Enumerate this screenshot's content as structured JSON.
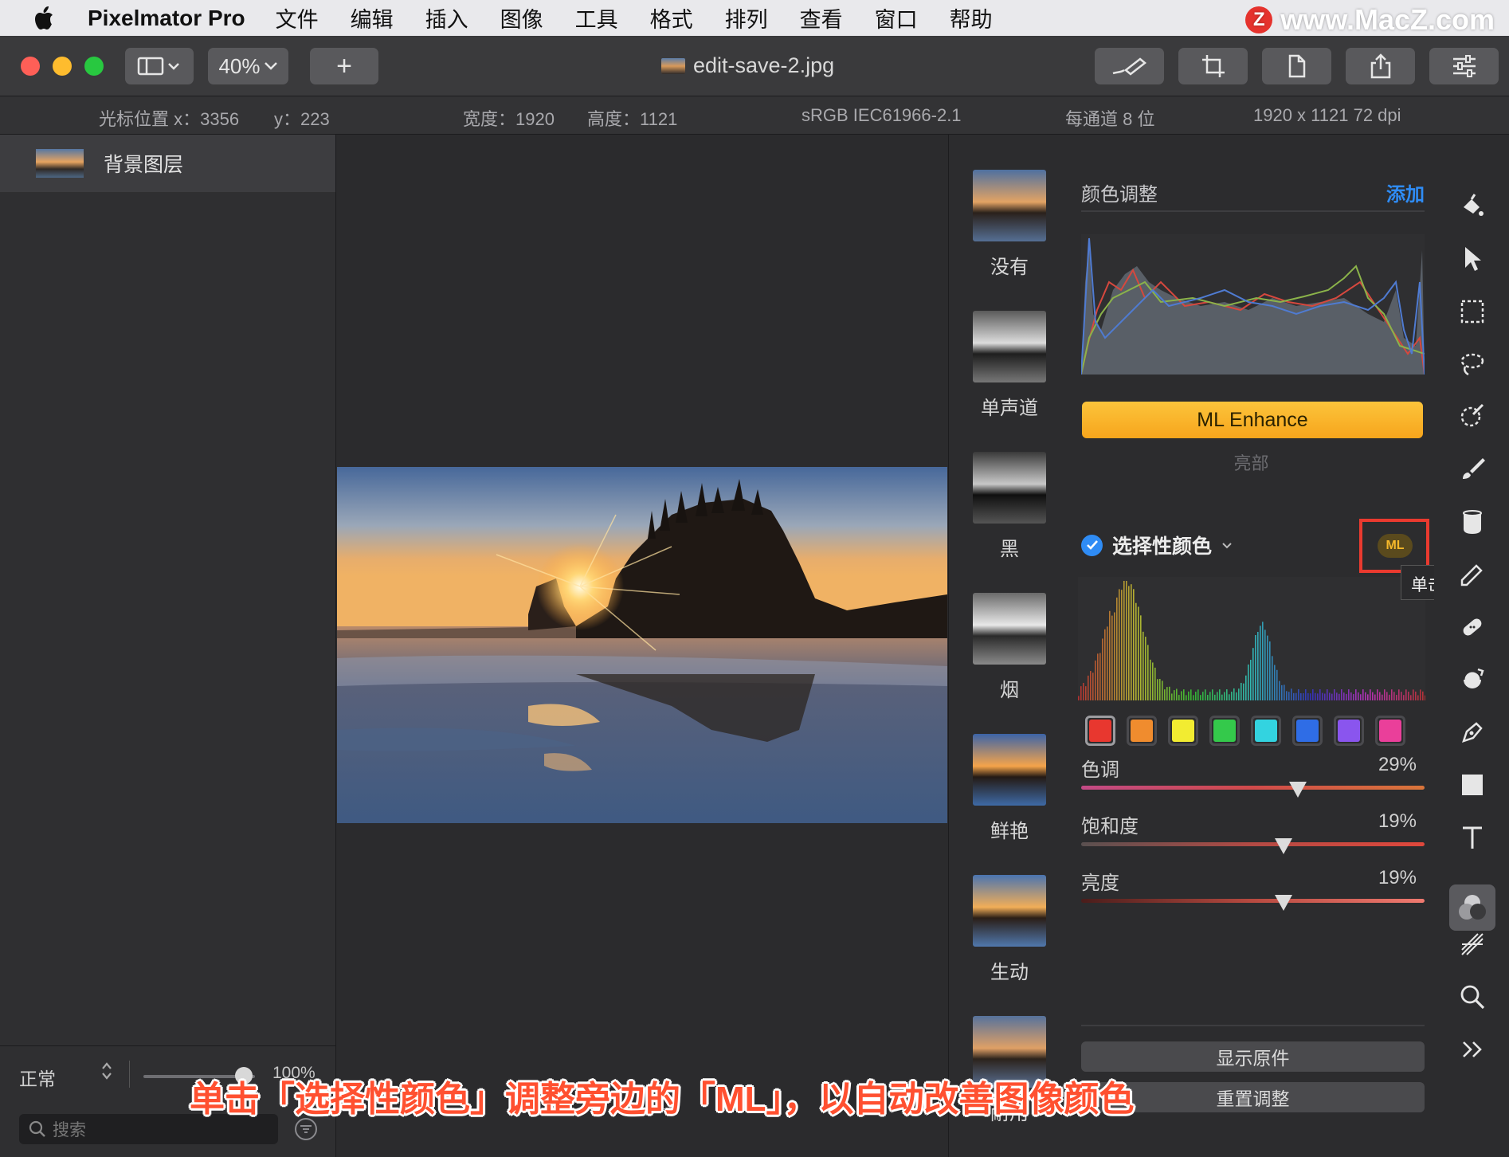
{
  "menubar": {
    "app_name": "Pixelmator Pro",
    "items": [
      "文件",
      "编辑",
      "插入",
      "图像",
      "工具",
      "格式",
      "排列",
      "查看",
      "窗口",
      "帮助"
    ],
    "watermark": "www.MacZ.com",
    "watermark_logo": "Z"
  },
  "toolbar": {
    "zoom": "40%",
    "add_label": "+",
    "document_title": "edit-save-2.jpg"
  },
  "infobar": {
    "cursor_x": "光标位置 x：3356",
    "cursor_y": "y：223",
    "width": "宽度：1920",
    "height": "高度：1121",
    "color_profile": "sRGB IEC61966-2.1",
    "bit_depth": "每通道 8 位",
    "image_size": "1920 x 1121 72 dpi"
  },
  "layers": {
    "items": [
      {
        "label": "背景图层"
      }
    ],
    "blend_mode": "正常",
    "opacity": "100%",
    "search_placeholder": "搜索"
  },
  "presets": [
    {
      "label": "没有"
    },
    {
      "label": "单声道"
    },
    {
      "label": "黑"
    },
    {
      "label": "烟"
    },
    {
      "label": "鲜艳"
    },
    {
      "label": "生动"
    },
    {
      "label": "耐用"
    }
  ],
  "adjustments": {
    "title": "颜色调整",
    "add_label": "添加",
    "ml_enhance_label": "ML Enhance",
    "light_label": "亮部",
    "selective_color_label": "选择性颜色",
    "ml_label": "ML",
    "tooltip": "单击以自动调整",
    "swatch_colors": [
      "#e8372f",
      "#f08c2e",
      "#f2ec31",
      "#34c94b",
      "#33d3e0",
      "#2f6de6",
      "#8a55ee",
      "#ea3f9a"
    ],
    "selected_swatch": 0,
    "sliders": [
      {
        "label": "色调",
        "value": "29%",
        "fraction": 0.63
      },
      {
        "label": "饱和度",
        "value": "19%",
        "fraction": 0.59
      },
      {
        "label": "亮度",
        "value": "19%",
        "fraction": 0.59
      }
    ],
    "show_original_label": "显示原件",
    "reset_label": "重置调整"
  },
  "tools": [
    "paint-bucket-icon",
    "arrow-icon",
    "rect-select-icon",
    "lasso-icon",
    "magic-wand-icon",
    "brush-icon",
    "fill-icon",
    "retouch-icon",
    "bandage-icon",
    "distort-icon",
    "pen-icon",
    "shape-icon",
    "text-icon",
    "color-adjust-icon",
    "effects-icon",
    "zoom-icon",
    "more-icon"
  ],
  "caption": "单击「选择性颜色」调整旁边的「ML」，以自动改善图像颜色",
  "colors": {
    "accent_blue": "#2f8cf5",
    "ml_yellow": "#f7a51c",
    "highlight_red": "#ea3a2f",
    "caption_red": "#ff5030"
  }
}
